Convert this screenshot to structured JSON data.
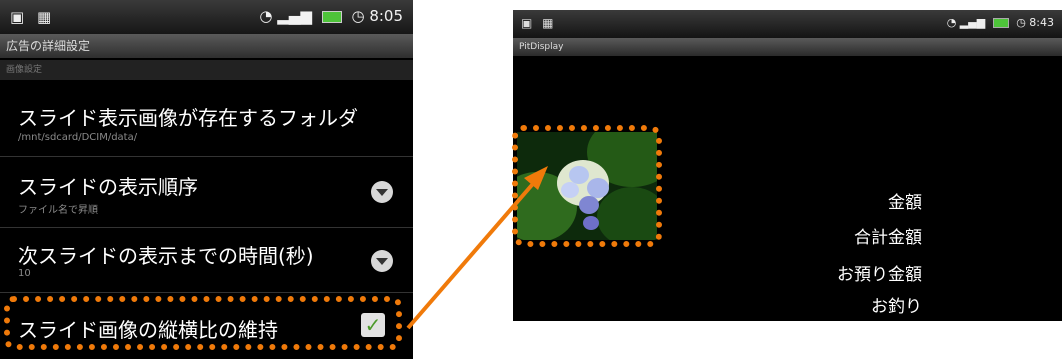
{
  "left_screen": {
    "status": {
      "time": "8:05"
    },
    "title": "広告の詳細設定",
    "section_header": "画像設定",
    "prefs": [
      {
        "title": "スライド表示画像が存在するフォルダ",
        "summary": "/mnt/sdcard/DCIM/data/"
      },
      {
        "title": "スライドの表示順序",
        "summary": "ファイル名で昇順"
      },
      {
        "title": "次スライドの表示までの時間(秒)",
        "summary": "10"
      },
      {
        "title": "スライド画像の縦横比の維持",
        "checked": true
      }
    ]
  },
  "right_screen": {
    "status": {
      "time": "8:43"
    },
    "title": "PitDisplay",
    "labels": [
      "金額",
      "合計金額",
      "お預り金額",
      "お釣り"
    ]
  },
  "colors": {
    "highlight": "#f07a0a",
    "arrow": "#f07a0a"
  }
}
